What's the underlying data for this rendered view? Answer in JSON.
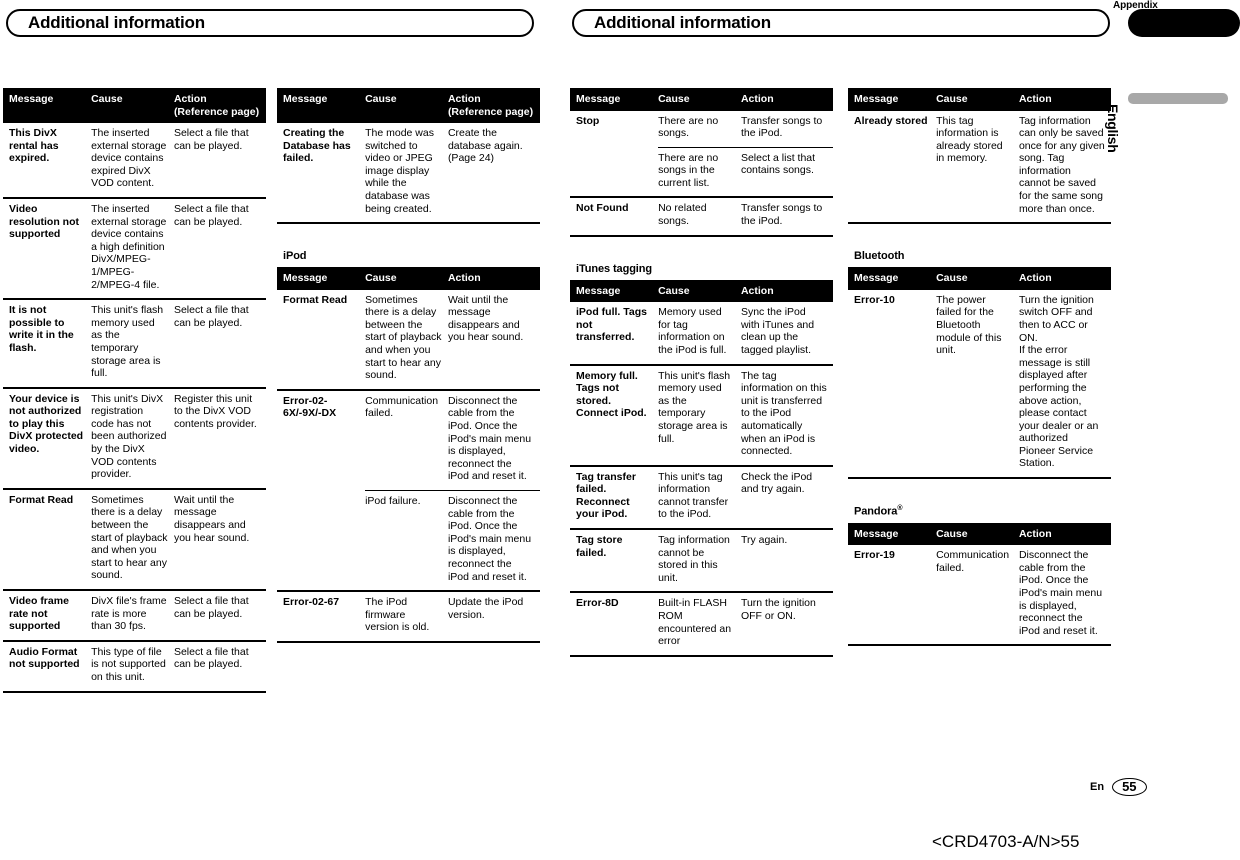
{
  "page": {
    "banner_left_title": "Additional information",
    "banner_right_title": "Additional information",
    "appendix_label": "Appendix",
    "language_tab": "English",
    "footer_language": "En",
    "footer_page_number": "55",
    "document_code": "<CRD4703-A/N>55"
  },
  "headers": {
    "message": "Message",
    "cause": "Cause",
    "action_ref": "Action (Reference page)",
    "action": "Action"
  },
  "columns": {
    "col1": {
      "tables": [
        {
          "section_heading": null,
          "headers": [
            "Message",
            "Cause",
            "Action (Reference page)"
          ],
          "rows": [
            {
              "message": "This DivX rental has expired.",
              "cause": "The inserted external storage device contains expired DivX VOD content.",
              "action": "Select a file that can be played."
            },
            {
              "message": "Video resolution not supported",
              "cause": "The inserted external storage device contains a high definition DivX/MPEG-1/MPEG-2/MPEG-4 file.",
              "action": "Select a file that can be played."
            },
            {
              "message": "It is not possible to write it in the flash.",
              "cause": "This unit's flash memory used as the temporary storage area is full.",
              "action": "Select a file that can be played."
            },
            {
              "message": "Your device is not authorized to play this DivX protected video.",
              "cause": "This unit's DivX registration code has not been authorized by the DivX VOD contents provider.",
              "action": "Register this unit to the DivX VOD contents provider."
            },
            {
              "message": "Format Read",
              "cause": "Sometimes there is a delay between the start of playback and when you start to hear any sound.",
              "action": "Wait until the message disappears and you hear sound."
            },
            {
              "message": "Video frame rate not supported",
              "cause": "DivX file's frame rate is more than 30 fps.",
              "action": "Select a file that can be played."
            },
            {
              "message": "Audio Format not supported",
              "cause": "This type of file is not supported on this unit.",
              "action": "Select a file that can be played."
            }
          ]
        }
      ]
    },
    "col2": {
      "tables": [
        {
          "section_heading": null,
          "headers": [
            "Message",
            "Cause",
            "Action (Reference page)"
          ],
          "rows": [
            {
              "message": "Creating the Database has failed.",
              "cause": "The mode was switched to video or JPEG image display while the database was being created.",
              "action": "Create the database again. (Page 24)"
            }
          ]
        },
        {
          "section_heading": "iPod",
          "headers": [
            "Message",
            "Cause",
            "Action"
          ],
          "rows": [
            {
              "message": "Format Read",
              "cause": "Sometimes there is a delay between the start of playback and when you start to hear any sound.",
              "action": "Wait until the message disappears and you hear sound."
            },
            {
              "message": "Error-02-6X/-9X/-DX",
              "cause": "Communication failed.",
              "action": "Disconnect the cable from the iPod. Once the iPod's main menu is displayed, reconnect the iPod and reset it."
            },
            {
              "message": "",
              "continuation": true,
              "cause": "iPod failure.",
              "action": "Disconnect the cable from the iPod. Once the iPod's main menu is displayed, reconnect the iPod and reset it."
            },
            {
              "message": "Error-02-67",
              "cause": "The iPod firmware version is old.",
              "action": "Update the iPod version."
            }
          ]
        }
      ]
    },
    "col3": {
      "tables": [
        {
          "section_heading": null,
          "headers": [
            "Message",
            "Cause",
            "Action"
          ],
          "rows": [
            {
              "message": "Stop",
              "cause": "There are no songs.",
              "action": "Transfer songs to the iPod."
            },
            {
              "message": "",
              "continuation": true,
              "cause": "There are no songs in the current list.",
              "action": "Select a list that contains songs."
            },
            {
              "message": "Not Found",
              "cause": "No related songs.",
              "action": "Transfer songs to the iPod."
            }
          ]
        },
        {
          "section_heading": "iTunes tagging",
          "headers": [
            "Message",
            "Cause",
            "Action"
          ],
          "rows": [
            {
              "message": "iPod full. Tags not transferred.",
              "cause": "Memory used for tag information on the iPod is full.",
              "action": "Sync the iPod with iTunes and clean up the tagged playlist."
            },
            {
              "message": "Memory full. Tags not stored. Connect iPod.",
              "cause": "This unit's flash memory used as the temporary storage area is full.",
              "action": "The tag information on this unit is transferred to the iPod automatically when an iPod is connected."
            },
            {
              "message": "Tag transfer failed. Reconnect your iPod.",
              "cause": "This unit's tag information cannot transfer to the iPod.",
              "action": "Check the iPod and try again."
            },
            {
              "message": "Tag store failed.",
              "cause": "Tag information cannot be stored in this unit.",
              "action": "Try again."
            },
            {
              "message": "Error-8D",
              "cause": "Built-in FLASH ROM encountered an error",
              "action": "Turn the ignition OFF or ON."
            }
          ]
        }
      ]
    },
    "col4": {
      "tables": [
        {
          "section_heading": null,
          "headers": [
            "Message",
            "Cause",
            "Action"
          ],
          "rows": [
            {
              "message": "Already stored",
              "cause": "This tag information is already stored in memory.",
              "action": "Tag information can only be saved once for any given song. Tag information cannot be saved for the same song more than once."
            }
          ]
        },
        {
          "section_heading": "Bluetooth",
          "headers": [
            "Message",
            "Cause",
            "Action"
          ],
          "rows": [
            {
              "message": "Error-10",
              "cause": "The power failed for the Bluetooth module of this unit.",
              "action": "Turn the ignition switch OFF and then to ACC or ON.\nIf the error message is still displayed after performing the above action, please contact your dealer or an authorized Pioneer Service Station."
            }
          ]
        },
        {
          "section_heading": "Pandora",
          "section_heading_sup": "®",
          "headers": [
            "Message",
            "Cause",
            "Action"
          ],
          "rows": [
            {
              "message": "Error-19",
              "cause": "Communication failed.",
              "action": "Disconnect the cable from the iPod. Once the iPod's main menu is displayed, reconnect the iPod and reset it."
            }
          ]
        }
      ]
    }
  }
}
